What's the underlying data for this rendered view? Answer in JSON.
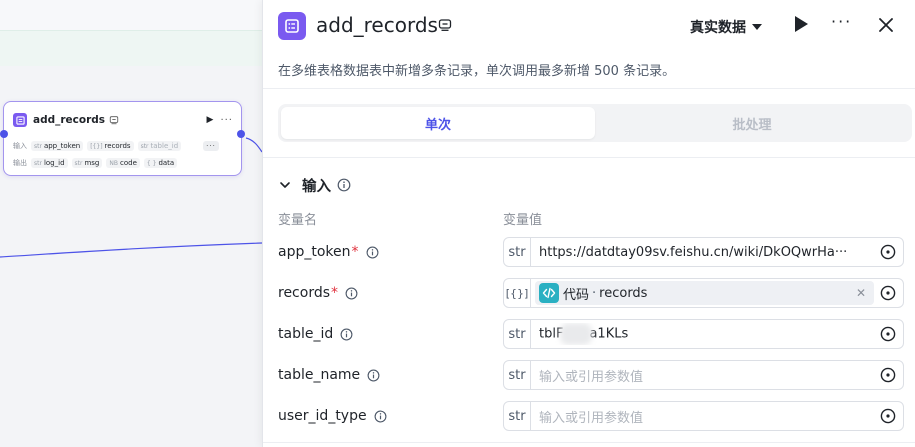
{
  "node": {
    "title": "add_records",
    "input_label": "输入",
    "output_label": "输出",
    "inputs": [
      {
        "type": "str",
        "name": "app_token"
      },
      {
        "type": "[{}]",
        "name": "records"
      },
      {
        "type": "str",
        "name": "table_id"
      }
    ],
    "more": "···",
    "outputs": [
      {
        "type": "str",
        "name": "log_id"
      },
      {
        "type": "str",
        "name": "msg"
      },
      {
        "type": "NB",
        "name": "code"
      },
      {
        "type": "{ }",
        "name": "data"
      }
    ]
  },
  "panel": {
    "title": "add_records",
    "mode_label": "真实数据",
    "description": "在多维表格数据表中新增多条记录，单次调用最多新增 500 条记录。",
    "tabs": [
      {
        "label": "单次",
        "active": true
      },
      {
        "label": "批处理",
        "active": false
      }
    ],
    "section_title": "输入",
    "col_name": "变量名",
    "col_value": "变量值",
    "params": [
      {
        "name": "app_token",
        "required": true,
        "type": "str",
        "value": "https://datdtay09sv.feishu.cn/wiki/DkOQwrHa···"
      },
      {
        "name": "records",
        "required": true,
        "type": "[{}]",
        "ref_label": "代码",
        "ref_sep": "·",
        "ref_value": "records"
      },
      {
        "name": "table_id",
        "required": false,
        "type": "str",
        "value_a": "tblF",
        "value_b": "a1KLs"
      },
      {
        "name": "table_name",
        "required": false,
        "type": "str",
        "placeholder": "输入或引用参数值"
      },
      {
        "name": "user_id_type",
        "required": false,
        "type": "str",
        "placeholder": "输入或引用参数值"
      }
    ]
  },
  "colors": {
    "accent": "#4d53e8",
    "node_icon": "#7a5af0",
    "code_icon": "#2ab0c2",
    "required": "#e0313d"
  }
}
